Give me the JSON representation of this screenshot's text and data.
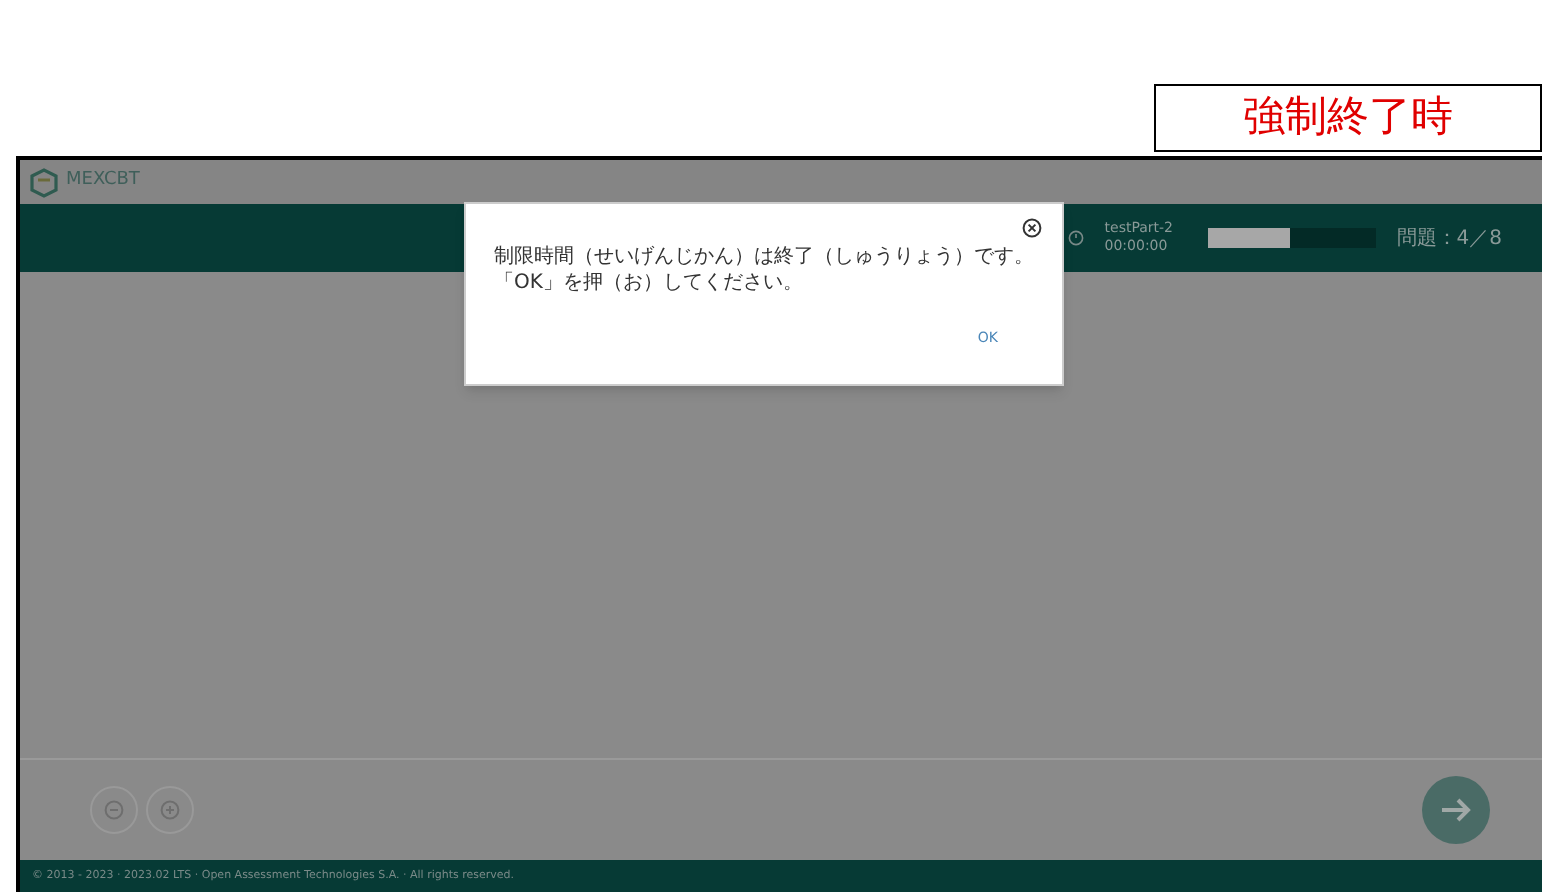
{
  "caption": "強制終了時",
  "header": {
    "logo": "MEXCBT"
  },
  "toolbar": {
    "section": "testPart-2",
    "timer": "00:00:00",
    "progress": {
      "level": 0.49
    },
    "question_counter": "問題：4／8"
  },
  "dialog": {
    "message_lines": [
      "制限時間（せいげんじかん）は終了（しゅうりょう）です。",
      "「OK」を押（お）してください。"
    ],
    "ok_button": "OK"
  },
  "footer": "© 2013 - 2023 · 2023.02 LTS · Open Assessment Technologies S.A. · All rights reserved."
}
